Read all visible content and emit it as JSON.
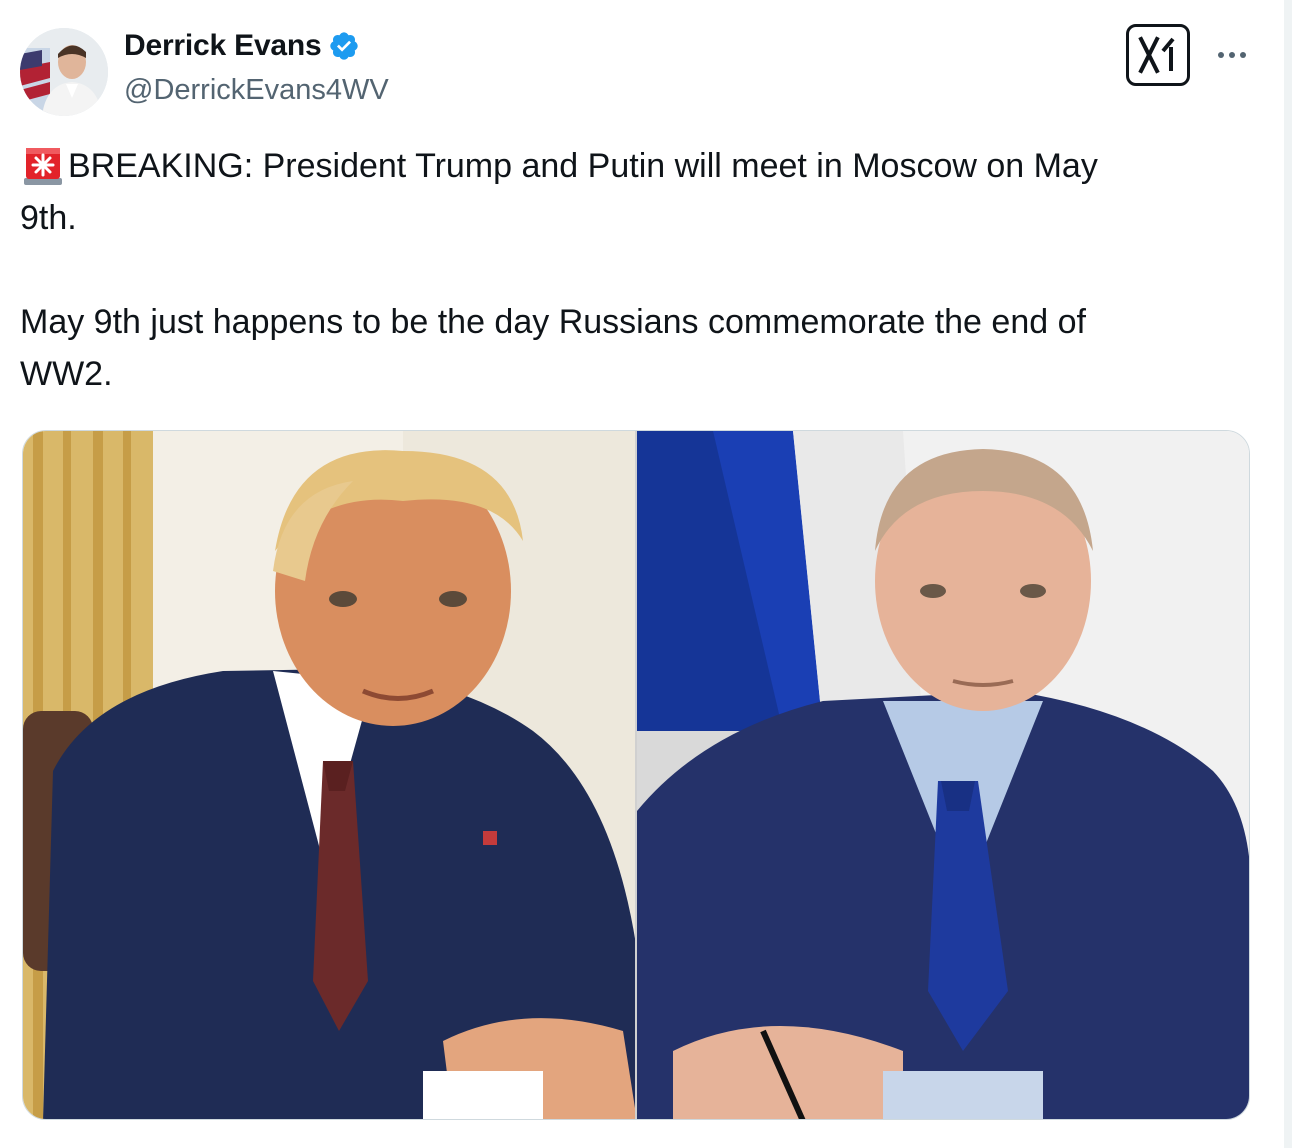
{
  "author": {
    "display_name": "Derrick Evans",
    "handle": "@DerrickEvans4WV",
    "verified": true,
    "avatar": "avatar-photo"
  },
  "actions": {
    "grok_icon": "grok-x-icon",
    "more_icon": "more-horizontal-icon"
  },
  "post": {
    "line1_icon": "rotating-light-emoji-icon",
    "text_part1": "BREAKING: President Trump and Putin will meet in Moscow on May\n9th.\n\nMay 9th just happens to be the day Russians commemorate the end of\nWW2."
  },
  "media": {
    "description_icon": "photo-collage-image",
    "colors": {
      "left_background": "#f3efe6",
      "right_flag_blue": "#1a3fb4",
      "suit": "#1f2c55"
    }
  },
  "colors": {
    "verified_blue": "#1d9bf0",
    "text_primary": "#0f1419",
    "text_secondary": "#536471",
    "siren_red": "#e2232a"
  }
}
